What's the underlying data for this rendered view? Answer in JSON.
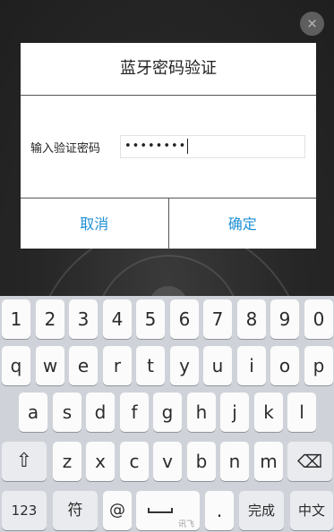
{
  "background": {
    "close_icon": "×"
  },
  "dialog": {
    "title": "蓝牙密码验证",
    "password_label": "输入验证密码",
    "password_value": "••••••••",
    "cancel_label": "取消",
    "confirm_label": "确定",
    "accent_color": "#1e8fd6"
  },
  "keyboard": {
    "row_numbers": [
      "1",
      "2",
      "3",
      "4",
      "5",
      "6",
      "7",
      "8",
      "9",
      "0"
    ],
    "row_top": [
      "q",
      "w",
      "e",
      "r",
      "t",
      "y",
      "u",
      "i",
      "o",
      "p"
    ],
    "row_mid": [
      "a",
      "s",
      "d",
      "f",
      "g",
      "h",
      "j",
      "k",
      "l"
    ],
    "row_bottom": [
      "z",
      "x",
      "c",
      "v",
      "b",
      "n",
      "m"
    ],
    "shift_icon": "⇧",
    "backspace_icon": "⌫",
    "key_123": "123",
    "key_symbol": "符",
    "key_at": "@",
    "space_brand": "讯飞",
    "key_period": ".",
    "key_done": "完成",
    "key_chinese": "中文"
  }
}
